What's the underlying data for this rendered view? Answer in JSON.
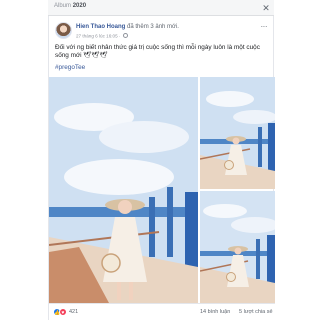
{
  "header": {
    "album_prefix": "Album",
    "album_year": "2020",
    "close_glyph": "✕"
  },
  "post": {
    "author_name": "Hien Thao Hoang",
    "author_action": "đã thêm 3 ảnh mới.",
    "timestamp": "27 tháng 6 lúc 16:05 ·",
    "privacy_icon": "globe-icon",
    "more_glyph": "···",
    "caption": "Đối với ng biết nhân thức giá trị cuộc sống thì mỗi ngày luôn là một cuộc sống mới 🕊🕊🕊",
    "hashtag": "#pregoTee",
    "photos": [
      {
        "alt": "main-photo",
        "icon": "photo"
      },
      {
        "alt": "side-photo-1",
        "icon": "photo"
      },
      {
        "alt": "side-photo-2",
        "icon": "photo"
      }
    ]
  },
  "footer": {
    "reactions": [
      "like",
      "love"
    ],
    "like_glyph": "👍",
    "love_glyph": "♥",
    "reaction_count": "421",
    "comments": "14 bình luận",
    "shares": "5 lượt chia sẻ"
  },
  "colors": {
    "link_blue": "#385898",
    "like_blue": "#1877f2",
    "love_red": "#f33e58",
    "sky": "#cfe0f2",
    "dress": "#f6efe6",
    "hat": "#d8c2a3"
  }
}
